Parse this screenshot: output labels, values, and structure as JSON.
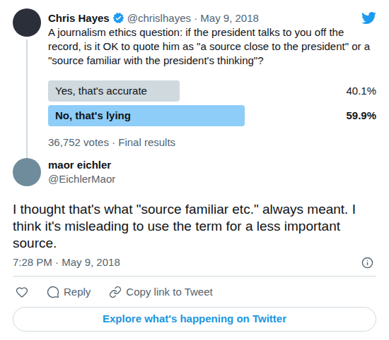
{
  "tweet": {
    "author": {
      "name": "Chris Hayes",
      "verified": true
    },
    "meta": "@chrislhayes · May 9, 2018",
    "text": "A journalism ethics question: if the president talks to you off the record, is it OK to quote him as \"a source close to the president\" or a \"source familiar with the president's thinking\"?",
    "poll": {
      "options": [
        {
          "label": "Yes, that's accurate",
          "percent": "40.1%",
          "level": 0.401,
          "selected": false
        },
        {
          "label": "No, that's lying",
          "percent": "59.9%",
          "level": 0.599,
          "selected": true
        }
      ],
      "summary": "36,752 votes · Final results"
    }
  },
  "reply": {
    "author": {
      "name": "maor eichler",
      "handle": "@EichlerMaor"
    },
    "text": "I thought that's what \"source familiar etc.\" always meant. I think it's misleading to use the term for a less important source.",
    "timestamp": "7:28 PM · May 9, 2018"
  },
  "actions": [
    {
      "kind": "like"
    },
    {
      "kind": "reply",
      "label": "Reply"
    },
    {
      "kind": "copy",
      "label": "Copy link to Tweet"
    }
  ],
  "button": "Explore what's happening on Twitter"
}
